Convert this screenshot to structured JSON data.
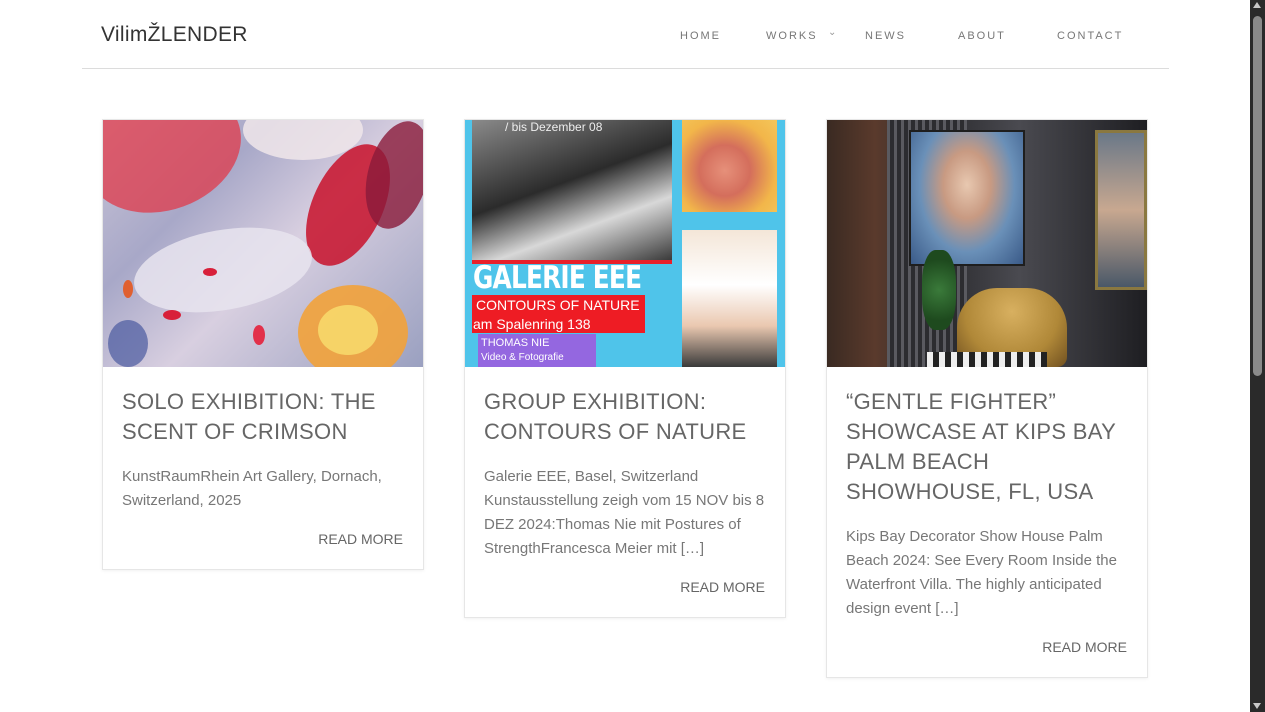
{
  "header": {
    "logo": "VilimŽLENDER",
    "nav": [
      {
        "label": "HOME"
      },
      {
        "label": "WORKS"
      },
      {
        "label": "NEWS"
      },
      {
        "label": "ABOUT"
      },
      {
        "label": "CONTACT"
      }
    ]
  },
  "cards": [
    {
      "title": "SOLO EXHIBITION: THE SCENT OF CRIMSON",
      "excerpt": "KunstRaumRhein Art Gallery, Dornach, Switzerland, 2025",
      "read_more": "READ MORE"
    },
    {
      "title": "GROUP EXHIBITION: CONTOURS OF NATURE",
      "excerpt": "Galerie EEE, Basel, Switzerland Kunstausstellung zeigh vom 15 NOV bis 8 DEZ 2024:Thomas Nie mit Postures of StrengthFrancesca Meier mit […]",
      "read_more": "READ MORE",
      "poster": {
        "top_text": "/ bis Dezember 08",
        "gallery": "GALERIE EEE",
        "line1": "CONTOURS OF NATURE",
        "line2": "am Spalenring 138",
        "line3": "THOMAS NIE",
        "line4": "Video & Fotografie"
      }
    },
    {
      "title": "“GENTLE FIGHTER” SHOWCASE AT KIPS BAY PALM BEACH SHOWHOUSE, FL, USA",
      "excerpt": "Kips Bay Decorator Show House Palm Beach 2024: See Every Room Inside the Waterfront Villa. The highly anticipated design event […]",
      "read_more": "READ MORE"
    }
  ],
  "icons": {
    "works_dropdown": "chevron-down-icon"
  }
}
